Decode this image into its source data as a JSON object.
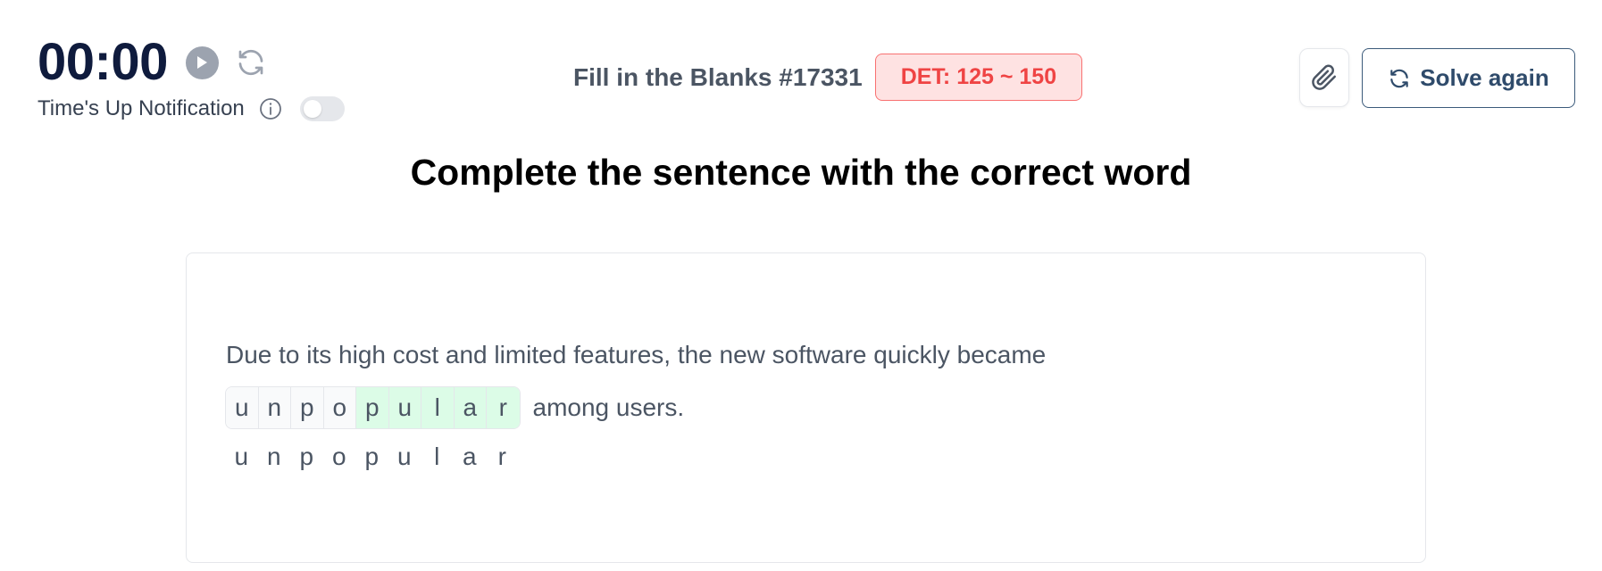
{
  "timer": {
    "value": "00:00",
    "notification_label": "Time's Up Notification",
    "notification_enabled": false
  },
  "header": {
    "title": "Fill in the Blanks #17331",
    "det_badge": "DET: 125 ~ 150",
    "solve_again_label": "Solve again"
  },
  "heading": "Complete the sentence with the correct word",
  "exercise": {
    "sentence_before": "Due to its high cost and limited features, the new software quickly became",
    "letters": [
      {
        "char": "u",
        "state": "given"
      },
      {
        "char": "n",
        "state": "given"
      },
      {
        "char": "p",
        "state": "given"
      },
      {
        "char": "o",
        "state": "given"
      },
      {
        "char": "p",
        "state": "filled"
      },
      {
        "char": "u",
        "state": "filled"
      },
      {
        "char": "l",
        "state": "filled"
      },
      {
        "char": "a",
        "state": "filled"
      },
      {
        "char": "r",
        "state": "filled"
      }
    ],
    "sentence_after": "among users.",
    "solution": [
      "u",
      "n",
      "p",
      "o",
      "p",
      "u",
      "l",
      "a",
      "r"
    ]
  },
  "colors": {
    "timer": "#0f1b3d",
    "badge_text": "#ef4444",
    "badge_bg": "#fee2e2",
    "filled_letter_bg": "#dcfce7",
    "solve_button": "#2f4b6b"
  },
  "icons": {
    "play": "play-icon",
    "reset": "refresh-icon",
    "info": "info-icon",
    "attach": "paperclip-icon",
    "solve": "refresh-icon"
  }
}
